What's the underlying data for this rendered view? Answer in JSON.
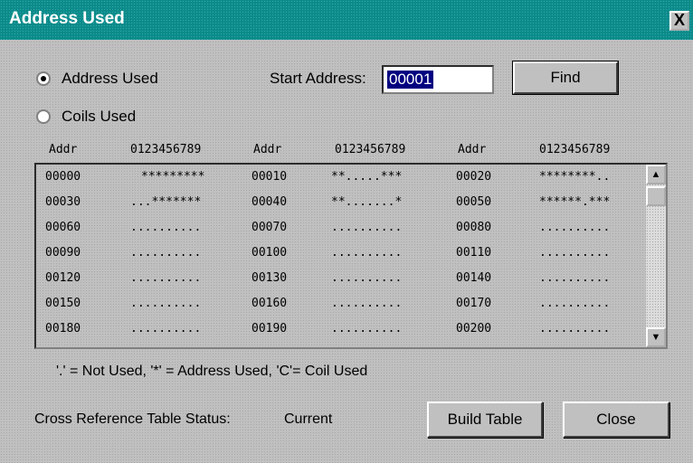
{
  "window": {
    "title": "Address Used",
    "close_glyph": "X"
  },
  "mode": {
    "options": [
      {
        "label": "Address Used",
        "selected": true
      },
      {
        "label": "Coils Used",
        "selected": false
      }
    ]
  },
  "start_address": {
    "label": "Start Address:",
    "value": "00001"
  },
  "buttons": {
    "find": "Find",
    "build_table": "Build Table",
    "close": "Close"
  },
  "table": {
    "headers": [
      "Addr",
      "0123456789",
      "Addr",
      "0123456789",
      "Addr",
      "0123456789"
    ],
    "rows": [
      [
        "00000",
        "*********",
        "00010",
        "**.....***",
        "00020",
        "********.."
      ],
      [
        "00030",
        "...*******",
        "00040",
        "**.......*",
        "00050",
        "******.***"
      ],
      [
        "00060",
        "..........",
        "00070",
        "..........",
        "00080",
        ".........."
      ],
      [
        "00090",
        "..........",
        "00100",
        "..........",
        "00110",
        ".........."
      ],
      [
        "00120",
        "..........",
        "00130",
        "..........",
        "00140",
        ".........."
      ],
      [
        "00150",
        "..........",
        "00160",
        "..........",
        "00170",
        ".........."
      ],
      [
        "00180",
        "..........",
        "00190",
        "..........",
        "00200",
        ".........."
      ]
    ]
  },
  "legend": "'.' = Not Used,   '*' = Address Used,   'C'= Coil Used",
  "status": {
    "label": "Cross Reference Table Status:",
    "value": "Current"
  },
  "scrollbar": {
    "up_icon": "arrow-up-icon",
    "down_icon": "arrow-down-icon"
  }
}
